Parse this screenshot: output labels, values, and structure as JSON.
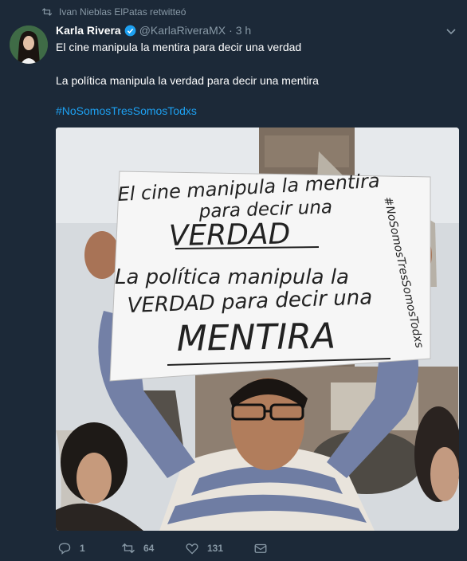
{
  "retweet": {
    "text": "Ivan Nieblas ElPatas retwitteó",
    "icon": "retweet-icon"
  },
  "tweet": {
    "author_name": "Karla Rivera",
    "verified": true,
    "handle": "@KarlaRiveraMX",
    "separator": "·",
    "time": "3 h",
    "line1": "El cine manipula la mentira para decir una verdad",
    "line2": "La política manipula la verdad para decir una mentira",
    "hashtag": "#NoSomosTresSomosTodxs"
  },
  "sign": {
    "line1": "El cine manipula la mentira",
    "line2": "para decir una",
    "line3": "VERDAD",
    "line4": "La política manipula la",
    "line5": "VERDAD para decir una",
    "line6": "MENTIRA",
    "side": "#NoSomosTresSomosTodxs"
  },
  "actions": {
    "replies": "1",
    "retweets": "64",
    "likes": "131"
  },
  "colors": {
    "background": "#1c2938",
    "secondary": "#8899a6",
    "link": "#1da1f2",
    "verified": "#1da1f2"
  }
}
